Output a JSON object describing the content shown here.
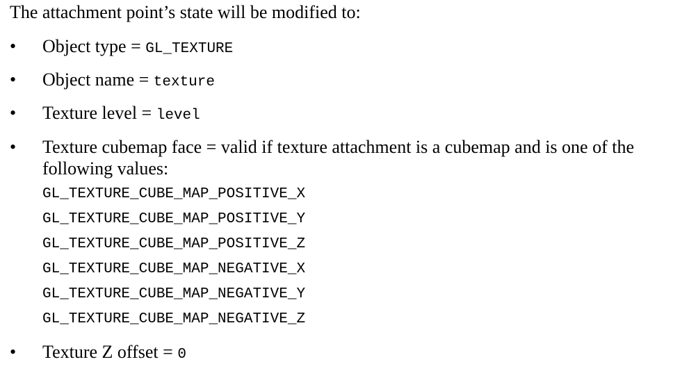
{
  "intro": "The attachment point’s state will be modified to:",
  "items": [
    {
      "bullet": "•",
      "label": "Object type = ",
      "code": "GL_TEXTURE"
    },
    {
      "bullet": "•",
      "label": "Object name = ",
      "code": "texture"
    },
    {
      "bullet": "•",
      "label": "Texture level = ",
      "code": "level"
    },
    {
      "bullet": "•",
      "label": "Texture cubemap face = valid if texture attachment is a cubemap and is one of the following values:"
    },
    {
      "bullet": "•",
      "label": "Texture Z offset = ",
      "code": "0"
    }
  ],
  "cubemap_values": [
    "GL_TEXTURE_CUBE_MAP_POSITIVE_X",
    "GL_TEXTURE_CUBE_MAP_POSITIVE_Y",
    "GL_TEXTURE_CUBE_MAP_POSITIVE_Z",
    "GL_TEXTURE_CUBE_MAP_NEGATIVE_X",
    "GL_TEXTURE_CUBE_MAP_NEGATIVE_Y",
    "GL_TEXTURE_CUBE_MAP_NEGATIVE_Z"
  ]
}
